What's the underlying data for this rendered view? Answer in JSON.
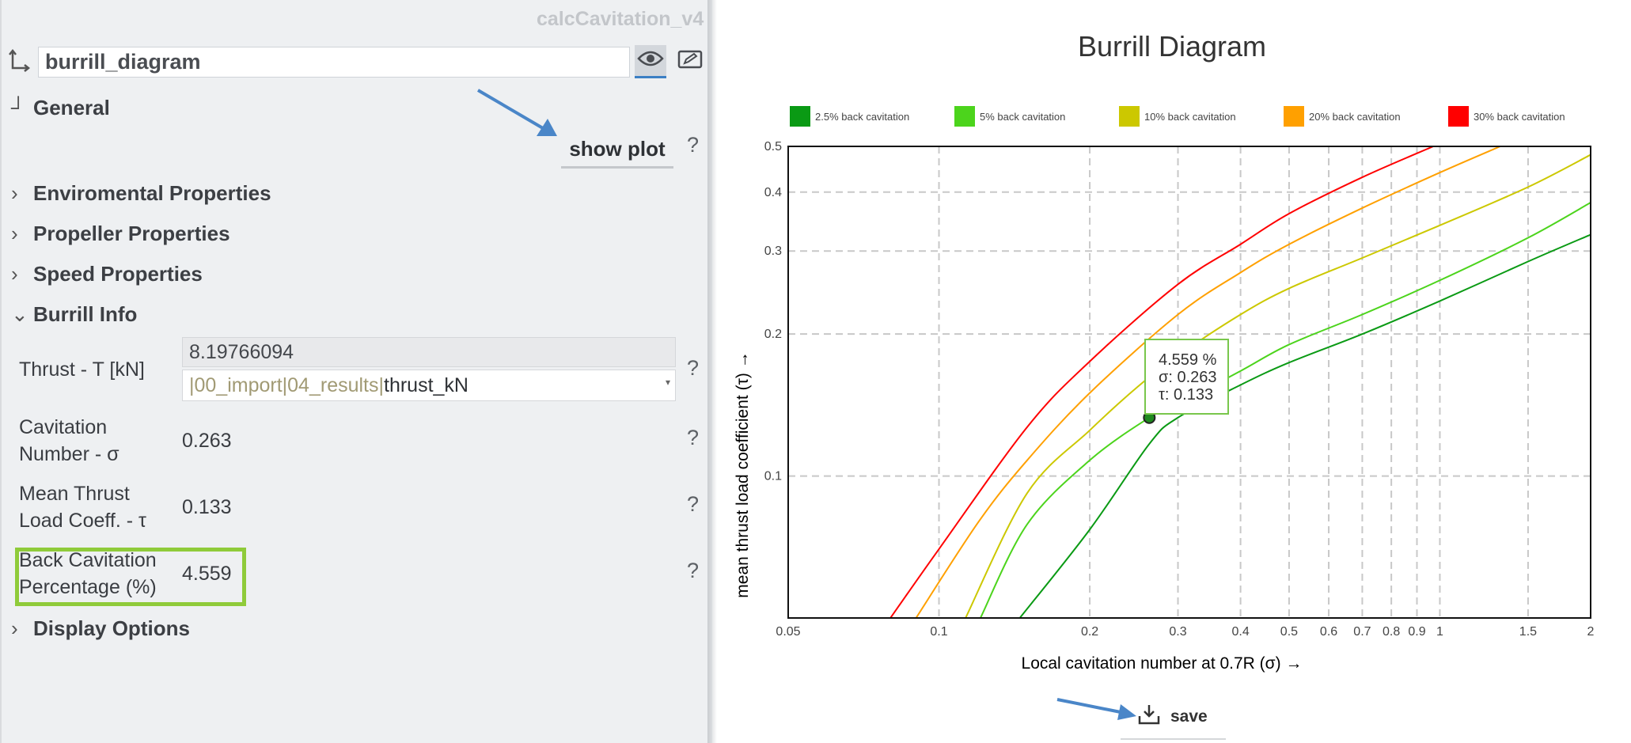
{
  "app": {
    "title": "calcCavitation_v4"
  },
  "node": {
    "name": "burrill_diagram"
  },
  "sections": {
    "general": "General",
    "environmental": "Enviromental Properties",
    "propeller": "Propeller Properties",
    "speed": "Speed Properties",
    "burrill": "Burrill Info",
    "display": "Display Options"
  },
  "show_plot_label": "show plot",
  "help_label": "?",
  "fields": {
    "thrust": {
      "label": "Thrust - T [kN]",
      "value": "8.19766094",
      "link_path": "|00_import|04_results|",
      "link_name": "thrust_kN"
    },
    "cavitation": {
      "label_line1": "Cavitation",
      "label_line2": "Number - σ",
      "value": "0.263"
    },
    "mean_thrust": {
      "label_line1": "Mean Thrust",
      "label_line2": "Load Coeff. - τ",
      "value": "0.133"
    },
    "back_cavitation": {
      "label_line1": "Back Cavitation",
      "label_line2": "Percentage (%)",
      "value": "4.559"
    }
  },
  "save_label": "save",
  "colors": {
    "accent": "#3b7fc4",
    "highlight": "#8fcb3a",
    "arrow": "#4a86c8"
  },
  "icons": {
    "eye": "eye-icon",
    "edit": "edit-icon",
    "download": "download-icon",
    "link": "tree-link-icon"
  },
  "chart_data": {
    "type": "line",
    "title": "Burrill Diagram",
    "xlabel": "Local cavitation number at 0.7R (σ) →",
    "ylabel": "mean thrust load coefficient (τ) →",
    "x_scale": "log",
    "y_scale": "log",
    "xlim": [
      0.05,
      2
    ],
    "ylim": [
      0.05,
      0.5
    ],
    "x_ticks": [
      "0.05",
      "0.1",
      "0.2",
      "0.3",
      "0.4",
      "0.5",
      "0.6",
      "0.7",
      "0.8",
      "0.9",
      "1",
      "1.5",
      "2"
    ],
    "x_tick_values": [
      0.05,
      0.1,
      0.2,
      0.3,
      0.4,
      0.5,
      0.6,
      0.7,
      0.8,
      0.9,
      1,
      1.5,
      2
    ],
    "y_ticks": [
      "0.1",
      "0.2",
      "0.3",
      "0.4",
      "0.5"
    ],
    "y_tick_values": [
      0.1,
      0.2,
      0.3,
      0.4,
      0.5
    ],
    "grid": true,
    "legend_position": "top",
    "series": [
      {
        "name": "2.5% back cavitation",
        "color": "#0a9a14",
        "x": [
          0.145,
          0.2,
          0.263,
          0.3,
          0.4,
          0.5,
          0.7,
          1,
          1.5,
          2
        ],
        "y": [
          0.05,
          0.077,
          0.117,
          0.133,
          0.156,
          0.174,
          0.2,
          0.235,
          0.285,
          0.325
        ]
      },
      {
        "name": "5% back cavitation",
        "color": "#4cd41c",
        "x": [
          0.121,
          0.15,
          0.2,
          0.263,
          0.3,
          0.4,
          0.5,
          0.7,
          1,
          1.5,
          2
        ],
        "y": [
          0.05,
          0.079,
          0.108,
          0.133,
          0.142,
          0.167,
          0.19,
          0.22,
          0.26,
          0.32,
          0.38
        ]
      },
      {
        "name": "10% back cavitation",
        "color": "#ccc800",
        "x": [
          0.113,
          0.15,
          0.2,
          0.25,
          0.3,
          0.4,
          0.5,
          0.7,
          1,
          1.5,
          2
        ],
        "y": [
          0.05,
          0.092,
          0.125,
          0.155,
          0.18,
          0.22,
          0.25,
          0.29,
          0.34,
          0.41,
          0.48
        ]
      },
      {
        "name": "20% back cavitation",
        "color": "#ffa000",
        "x": [
          0.09,
          0.12,
          0.15,
          0.2,
          0.3,
          0.4,
          0.5,
          0.7,
          1,
          1.32
        ],
        "y": [
          0.05,
          0.08,
          0.108,
          0.15,
          0.22,
          0.27,
          0.31,
          0.37,
          0.44,
          0.5
        ]
      },
      {
        "name": "30% back cavitation",
        "color": "#ff0000",
        "x": [
          0.08,
          0.1,
          0.15,
          0.2,
          0.3,
          0.4,
          0.5,
          0.7,
          0.97
        ],
        "y": [
          0.05,
          0.07,
          0.127,
          0.175,
          0.255,
          0.31,
          0.36,
          0.43,
          0.5
        ]
      }
    ],
    "marker": {
      "x": 0.263,
      "y": 0.133,
      "percent": "4.559 %",
      "sigma_label": "σ: 0.263",
      "tau_label": "τ:  0.133"
    }
  }
}
